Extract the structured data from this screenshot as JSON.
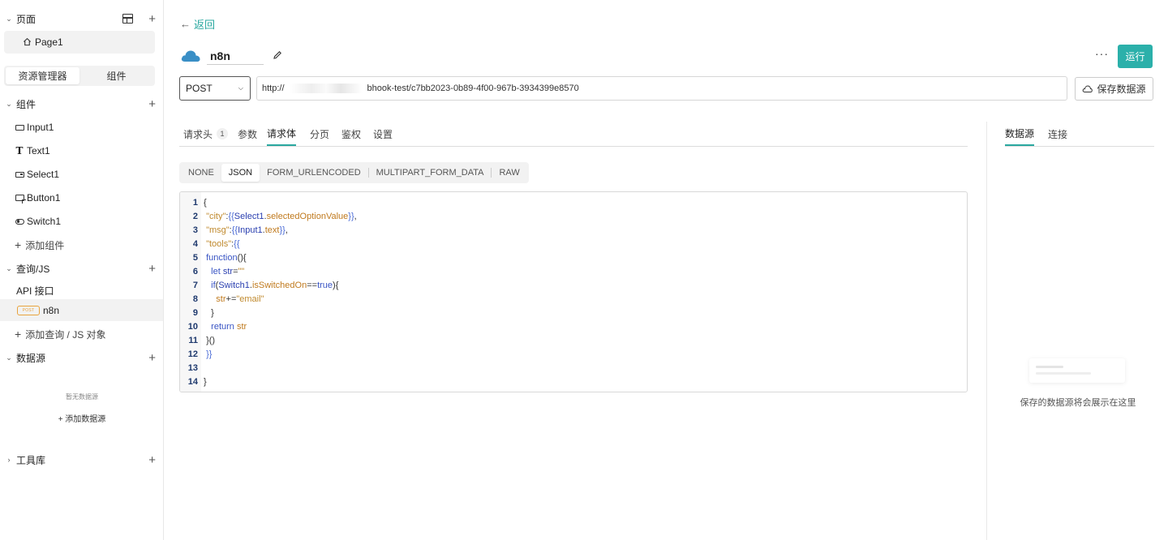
{
  "sidebar": {
    "pages_section": {
      "title": "页面",
      "add": "+"
    },
    "pages": [
      {
        "label": "Page1"
      }
    ],
    "segment": {
      "explorer": "资源管理器",
      "components": "组件"
    },
    "components_section": {
      "title": "组件",
      "add": "+"
    },
    "components": [
      {
        "label": "Input1",
        "icon": "input-icon"
      },
      {
        "label": "Text1",
        "icon": "text-icon"
      },
      {
        "label": "Select1",
        "icon": "select-icon"
      },
      {
        "label": "Button1",
        "icon": "button-icon"
      },
      {
        "label": "Switch1",
        "icon": "switch-icon"
      }
    ],
    "add_component": "添加组件",
    "query_section": {
      "title": "查询/JS",
      "add": "+"
    },
    "api_label": "API 接口",
    "query_item": {
      "method": "POST",
      "label": "n8n"
    },
    "add_query": "添加查询 / JS 对象",
    "datasource_section": {
      "title": "数据源",
      "add": "+"
    },
    "datasource_empty": "暂无数据源",
    "add_datasource": "+ 添加数据源",
    "tools_section": {
      "title": "工具库",
      "add": "+"
    }
  },
  "header": {
    "back": "返回",
    "query_name": "n8n",
    "more": "···",
    "run": "运行"
  },
  "request": {
    "method": "POST",
    "url_prefix": "http://",
    "url_suffix": "bhook-test/c7bb2023-0b89-4f00-967b-3934399e8570",
    "save_datasource": "保存数据源"
  },
  "tabs": [
    {
      "label": "请求头",
      "count": "1"
    },
    {
      "label": "参数"
    },
    {
      "label": "请求体",
      "active": true
    },
    {
      "label": "分页"
    },
    {
      "label": "鉴权"
    },
    {
      "label": "设置"
    }
  ],
  "body_types": [
    "NONE",
    "JSON",
    "FORM_URLENCODED",
    "MULTIPART_FORM_DATA",
    "RAW"
  ],
  "body_type_selected": "JSON",
  "editor": {
    "line_numbers": [
      "1",
      "2",
      "3",
      "4",
      "5",
      "6",
      "7",
      "8",
      "9",
      "10",
      "11",
      "12",
      "13",
      "14"
    ]
  },
  "right_panel": {
    "tabs": [
      "数据源",
      "连接"
    ],
    "empty_text": "保存的数据源将会展示在这里"
  },
  "colors": {
    "accent": "#2bb0aa",
    "post_badge": "#e8a33c"
  }
}
